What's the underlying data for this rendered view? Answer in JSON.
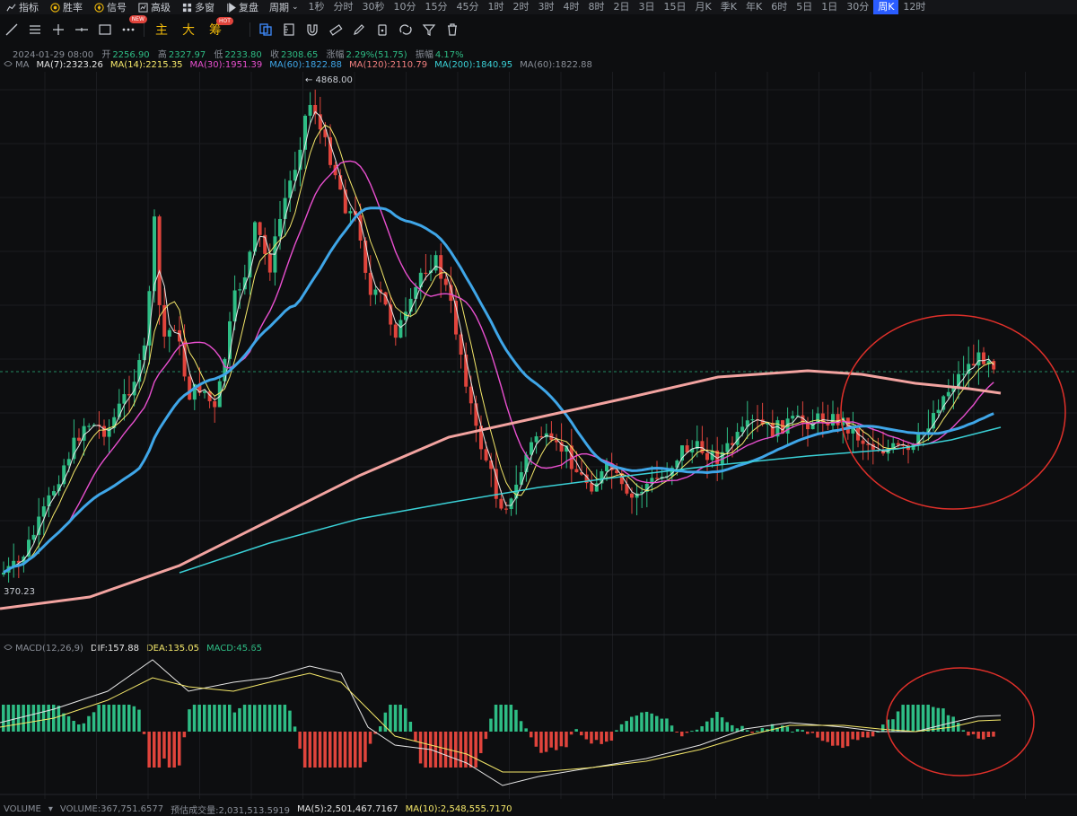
{
  "toolbar": {
    "indicators_label": "指标",
    "winrate_label": "胜率",
    "signal_label": "信号",
    "advanced_label": "高级",
    "multi_window_label": "多窗",
    "replay_label": "复盘",
    "period_label": "周期",
    "periods": [
      "1秒",
      "分时",
      "30秒",
      "10分",
      "15分",
      "45分",
      "1时",
      "2时",
      "3时",
      "4时",
      "8时",
      "2日",
      "3日",
      "15日",
      "月K",
      "季K",
      "年K",
      "6时",
      "5日",
      "1日",
      "30分",
      "周K",
      "12时"
    ],
    "active_period": "周K",
    "main_label": "主",
    "big_label": "大",
    "chip_label": "筹",
    "new_badge": "NEW",
    "hot_badge": "HOT"
  },
  "candle_info": {
    "date": "2024-01-29 08:00",
    "open_label": "开",
    "open": "2256.90",
    "high_label": "高",
    "high": "2327.97",
    "low_label": "低",
    "low": "2233.80",
    "close_label": "收",
    "close": "2308.65",
    "change_label": "涨幅",
    "change": "2.29%(51.75)",
    "amplitude_label": "振幅",
    "amplitude": "4.17%"
  },
  "ma_legend": {
    "prefix": "MA",
    "items": [
      {
        "label": "MA(7):2323.26",
        "color": "#e6e6e6"
      },
      {
        "label": "MA(14):2215.35",
        "color": "#f5e86a"
      },
      {
        "label": "MA(30):1951.39",
        "color": "#e84fcf"
      },
      {
        "label": "MA(60):1822.88",
        "color": "#3fa6e8"
      },
      {
        "label": "MA(120):2110.79",
        "color": "#f07f7f"
      },
      {
        "label": "MA(200):1840.95",
        "color": "#3ad0d6"
      },
      {
        "label": "MA(60):1822.88",
        "color": "#8a8f98"
      }
    ]
  },
  "price_labels": {
    "high_marker": "← 4868.00",
    "low_marker": "370.23"
  },
  "macd": {
    "title": "MACD(12,26,9)",
    "dif": "DIF:157.88",
    "dea": "DEA:135.05",
    "macd": "MACD:45.65"
  },
  "volume": {
    "title": "VOLUME",
    "volume": "VOLUME:367,751.6577",
    "estimated": "预估成交量:2,031,513.5919",
    "ma5": "MA(5):2,501,467.7167",
    "ma10": "MA(10):2,548,555.7170"
  },
  "colors": {
    "up": "#2ebd85",
    "down": "#e0443c",
    "accent": "#2a5cff",
    "annotation": "#e0302a"
  }
}
